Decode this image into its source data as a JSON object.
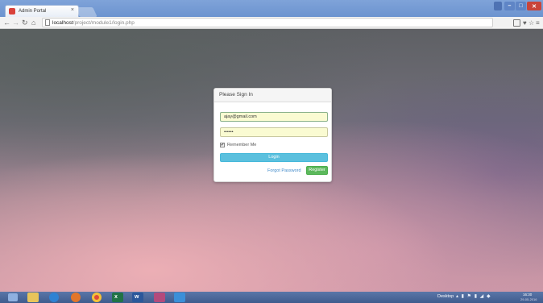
{
  "browser": {
    "tab_title": "Admin Portal",
    "tab_close": "×",
    "url_host": "localhost",
    "url_path": "/project/module1/login.php"
  },
  "login": {
    "heading": "Please Sign In",
    "email_value": "ajay@gmail.com",
    "password_value": "••••••",
    "remember_checked": true,
    "remember_label": "Remember Me",
    "login_label": "Login",
    "forgot_label": "Forgot Password",
    "register_label": "Register"
  },
  "taskbar": {
    "desktop_label": "Desktop",
    "time": "16:30",
    "date": "29-05-2016"
  },
  "colors": {
    "login_button": "#5bc0de",
    "register_button": "#5cb85c",
    "link": "#428bca"
  },
  "icons": [
    "favicon-icon",
    "back-icon",
    "forward-icon",
    "reload-icon",
    "home-icon",
    "star-icon",
    "menu-icon",
    "windows-icon",
    "explorer-icon",
    "ie-icon",
    "firefox-icon",
    "chrome-icon",
    "excel-icon",
    "word-icon"
  ]
}
